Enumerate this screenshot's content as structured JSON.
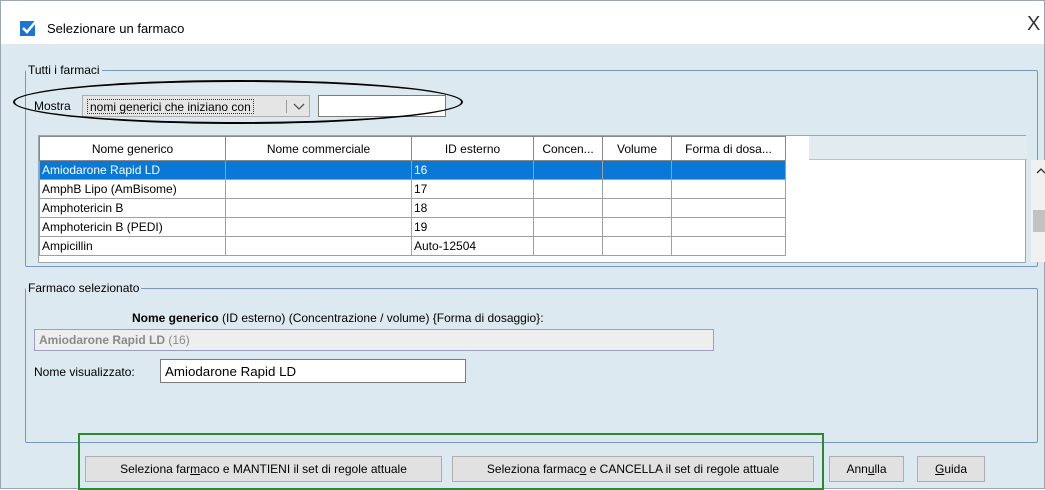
{
  "window": {
    "title": "Selezionare un farmaco",
    "close_glyph": "X",
    "icon": "check-icon",
    "accent": "#0a78d7"
  },
  "all_drugs": {
    "legend": "Tutti i farmaci",
    "filter_label": "Mostra",
    "filter_selected": "nomi generici che iniziano con",
    "filter_value": "",
    "columns": [
      "Nome generico",
      "Nome commerciale",
      "ID esterno",
      "Concen...",
      "Volume",
      "Forma di dosa..."
    ],
    "rows": [
      [
        "Amiodarone Rapid LD",
        "",
        "16",
        "",
        "",
        ""
      ],
      [
        "AmphB Lipo (AmBisome)",
        "",
        "17",
        "",
        "",
        ""
      ],
      [
        "Amphotericin B",
        "",
        "18",
        "",
        "",
        ""
      ],
      [
        "Amphotericin B (PEDI)",
        "",
        "19",
        "",
        "",
        ""
      ],
      [
        "Ampicillin",
        "",
        "Auto-12504",
        "",
        "",
        ""
      ]
    ],
    "selected_row": 0
  },
  "selected": {
    "legend": "Farmaco selezionato",
    "caption_bold": "Nome generico",
    "caption_rest": " (ID esterno) (Concentrazione / volume) {Forma di dosaggio}:",
    "generic_name": "Amiodarone Rapid LD",
    "generic_id": " (16)",
    "display_label": "Nome visualizzato:",
    "display_value": "Amiodarone Rapid LD"
  },
  "buttons": {
    "keep_pre": "Seleziona far",
    "keep_u": "m",
    "keep_post": "aco e MANTIENI il set di regole attuale",
    "cancel_pre": "Seleziona farmac",
    "cancel_u": "o",
    "cancel_post": " e CANCELLA il set di regole attuale",
    "annulla_pre": "Ann",
    "annulla_u": "u",
    "annulla_post": "lla",
    "guida_pre": "",
    "guida_u": "G",
    "guida_post": "uida"
  }
}
